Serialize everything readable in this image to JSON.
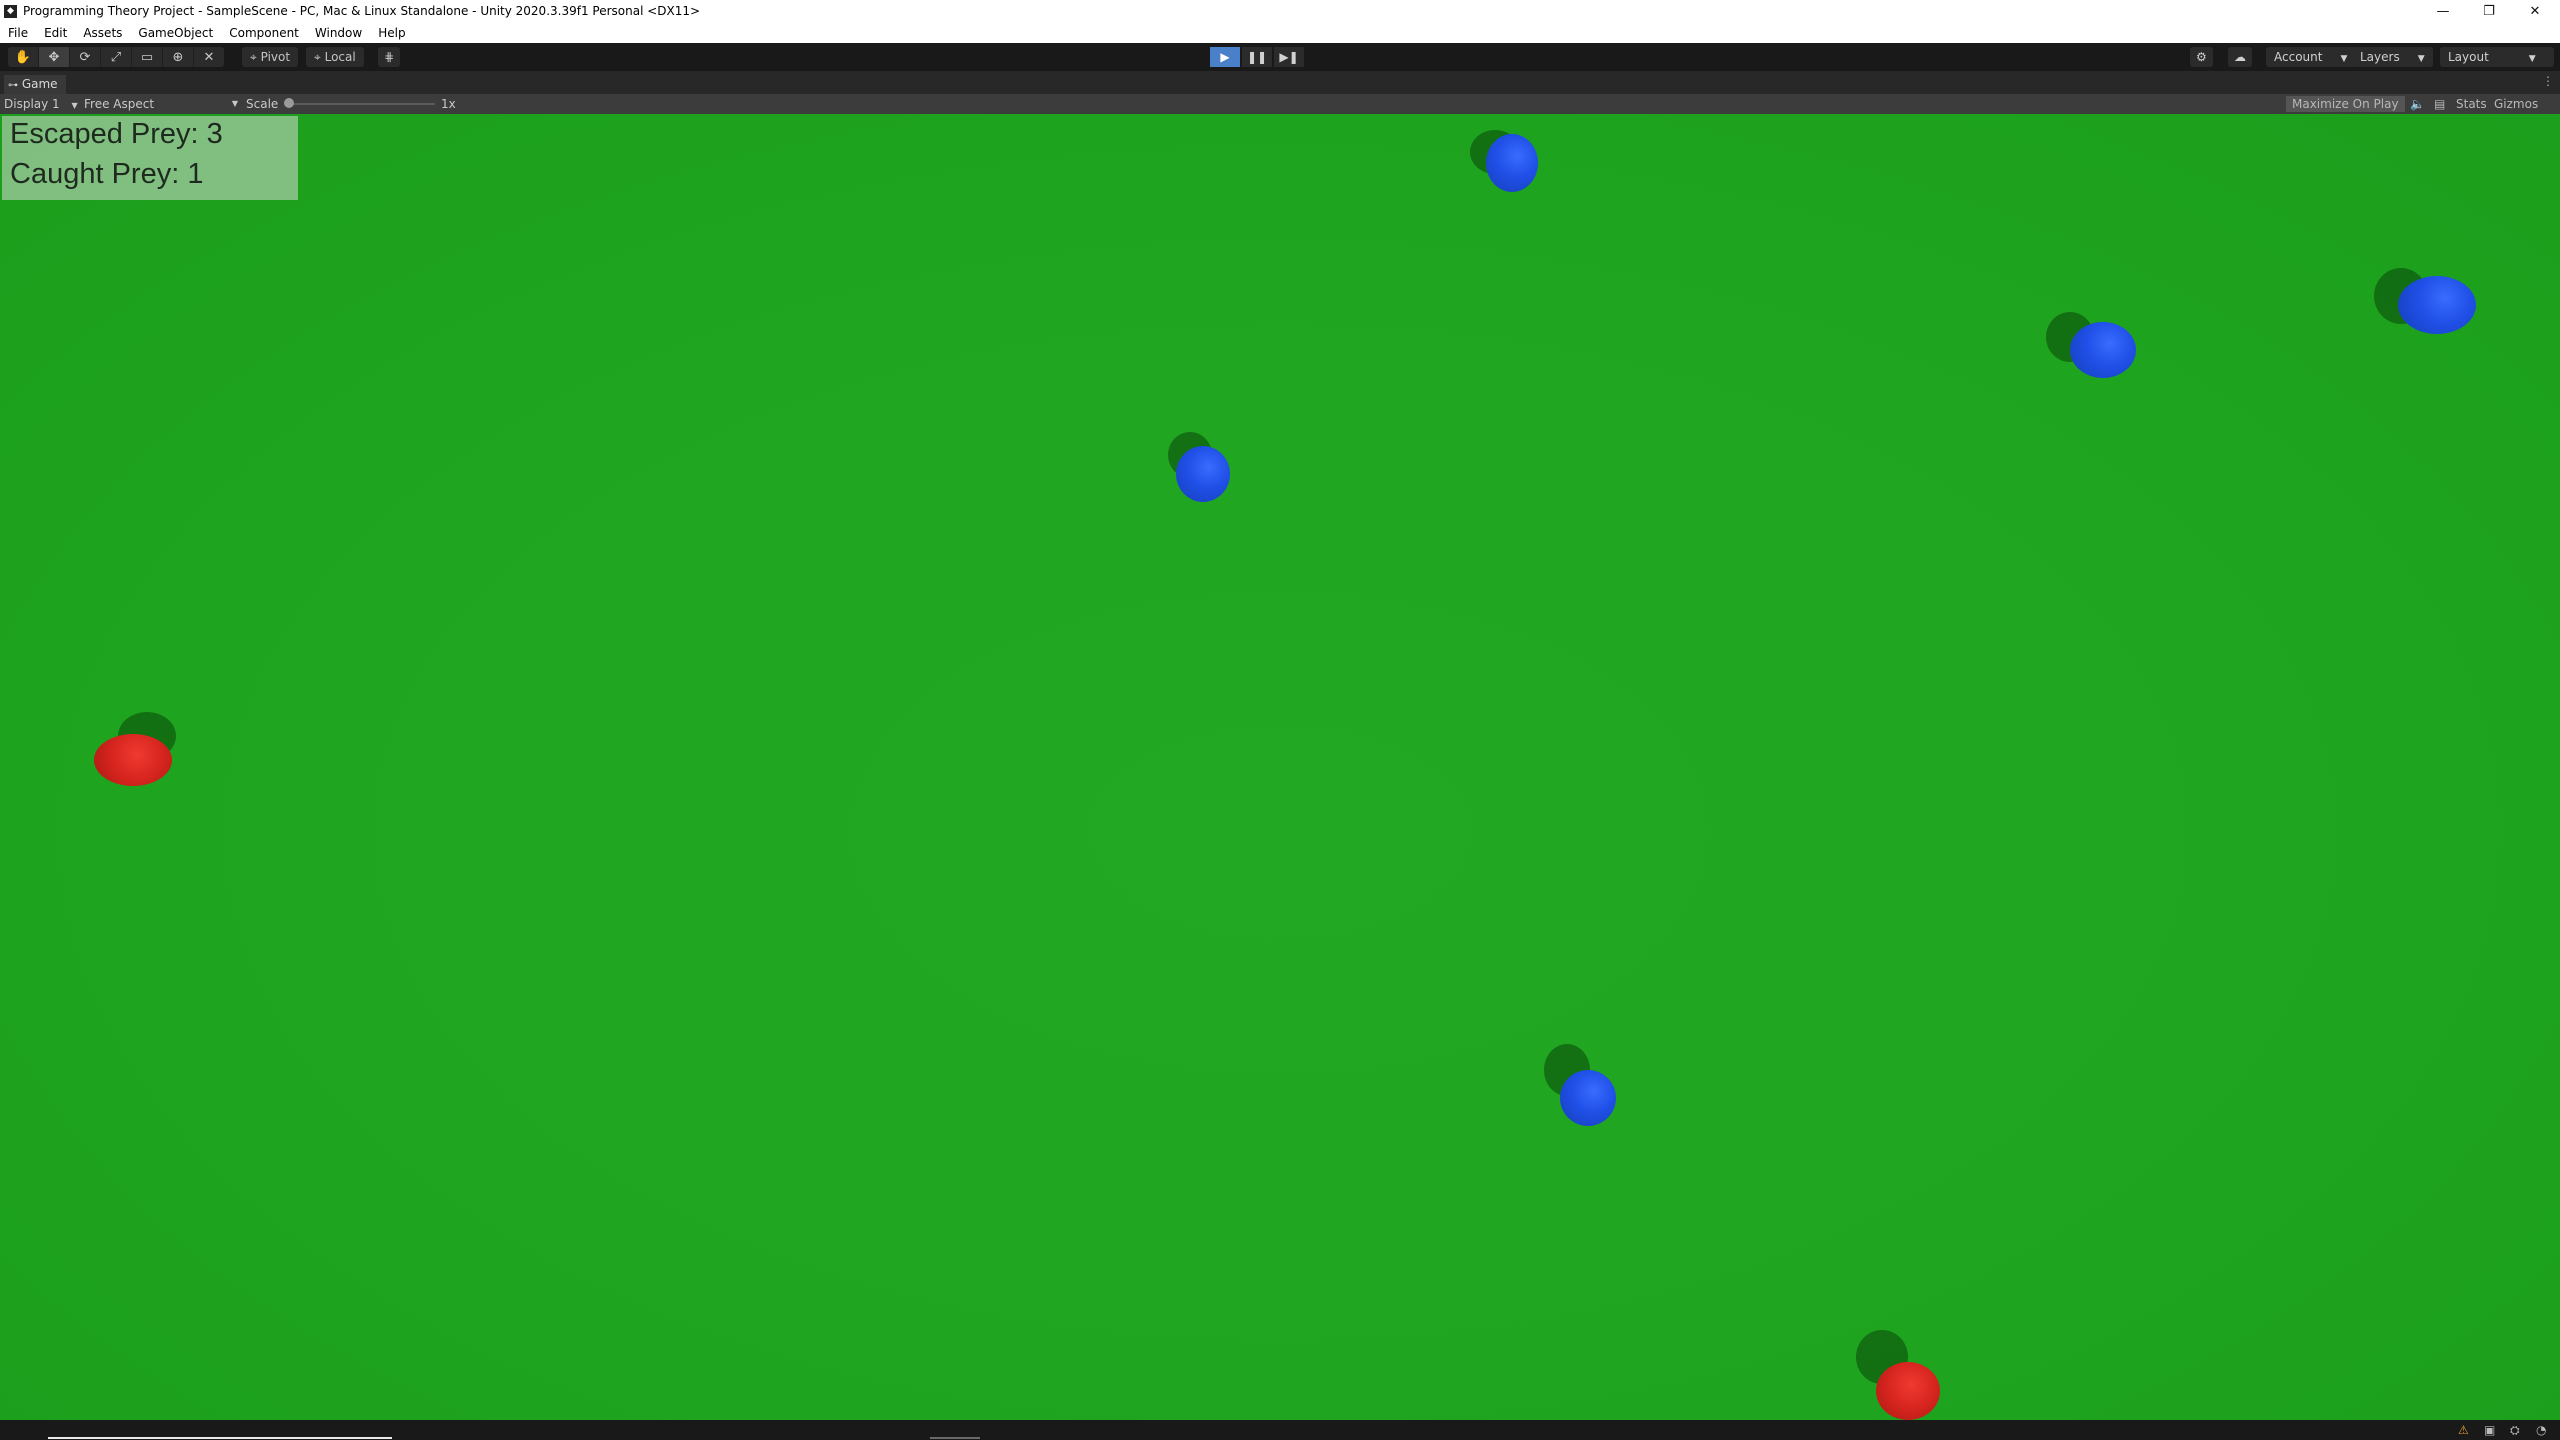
{
  "window": {
    "title": "Programming Theory Project - SampleScene - PC, Mac & Linux Standalone - Unity 2020.3.39f1 Personal <DX11>",
    "minimize_icon": "minimize-icon",
    "restore_icon": "restore-icon",
    "close_icon": "close-icon"
  },
  "menu": [
    "File",
    "Edit",
    "Assets",
    "GameObject",
    "Component",
    "Window",
    "Help"
  ],
  "toolbar": {
    "tools": [
      "hand-tool-icon",
      "move-tool-icon",
      "rotate-tool-icon",
      "scale-tool-icon",
      "rect-tool-icon",
      "transform-tool-icon",
      "custom-tool-icon"
    ],
    "pivot_label": "Pivot",
    "local_label": "Local",
    "grid_snap_icon": "grid-snap-icon",
    "play_state": "playing",
    "account_label": "Account",
    "layers_label": "Layers",
    "layout_label": "Layout"
  },
  "game_tab": {
    "label": "Game"
  },
  "game_controls": {
    "display": "Display 1",
    "aspect": "Free Aspect",
    "scale_label": "Scale",
    "scale_value": "1x",
    "maximize_on_play": "Maximize On Play",
    "stats": "Stats",
    "gizmos": "Gizmos"
  },
  "hud": {
    "escaped": "Escaped Prey: 3",
    "caught": "Caught Prey: 1"
  },
  "colors": {
    "ground": "#1fa51f",
    "prey": "#1f4fe6",
    "predator": "#d5241e"
  },
  "entities": [
    {
      "type": "prey",
      "color": "blue"
    },
    {
      "type": "prey",
      "color": "blue"
    },
    {
      "type": "prey",
      "color": "blue"
    },
    {
      "type": "prey",
      "color": "blue"
    },
    {
      "type": "prey",
      "color": "blue"
    },
    {
      "type": "predator",
      "color": "red"
    },
    {
      "type": "predator",
      "color": "red"
    }
  ]
}
